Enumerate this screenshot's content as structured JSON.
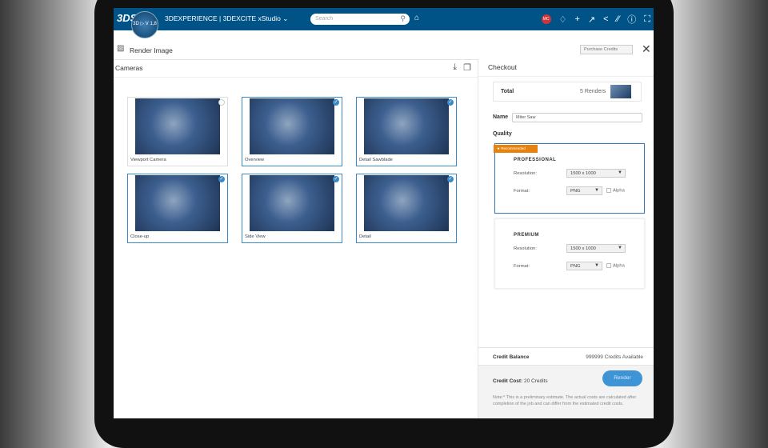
{
  "topbar": {
    "logo": "3DS",
    "compass_label": "3D ▷ V  1,8",
    "brand": "3DEXPERIENCE | 3DEXCITE xStudio ⌄",
    "search_placeholder": "Search",
    "avatar": "MC"
  },
  "dialog": {
    "title": "Render Image",
    "purchase_label": "Purchase Credits"
  },
  "cameras": {
    "header": "Cameras",
    "items": [
      {
        "label": "Viewport Camera",
        "selected": false
      },
      {
        "label": "Overview",
        "selected": true
      },
      {
        "label": "Detail Sawblade",
        "selected": true
      },
      {
        "label": "Close-up",
        "selected": true
      },
      {
        "label": "Side View",
        "selected": true
      },
      {
        "label": "Detail",
        "selected": true
      }
    ]
  },
  "checkout": {
    "header": "Checkout",
    "total_label": "Total",
    "total_value": "5 Renders",
    "name_label": "Name",
    "name_value": "Miter Saw",
    "quality_label": "Quality",
    "qualities": [
      {
        "badge": "Recommended",
        "title": "PROFESSIONAL",
        "resolution_label": "Resolution:",
        "resolution": "1500 x 1000",
        "format_label": "Format:",
        "format": "PNG",
        "alpha_label": "Alpha",
        "selected": true
      },
      {
        "title": "PREMIUM",
        "resolution_label": "Resolution:",
        "resolution": "1500 x 1000",
        "format_label": "Format:",
        "format": "PNG",
        "alpha_label": "Alpha",
        "selected": false
      }
    ],
    "balance_label": "Credit Balance",
    "balance_value": "999999 Credits Available",
    "cost_label": "Credit Cost:",
    "cost_value": "20 Credits",
    "render_label": "Render",
    "note": "Note:* This is a preliminary estimate. The actual costs are calculated after completion of the job and can differ from the estimated credit costs."
  },
  "colors": {
    "topbar": "#005386",
    "accent": "#3a8ac9",
    "badge": "#e8820c",
    "render": "#3f94d6"
  }
}
